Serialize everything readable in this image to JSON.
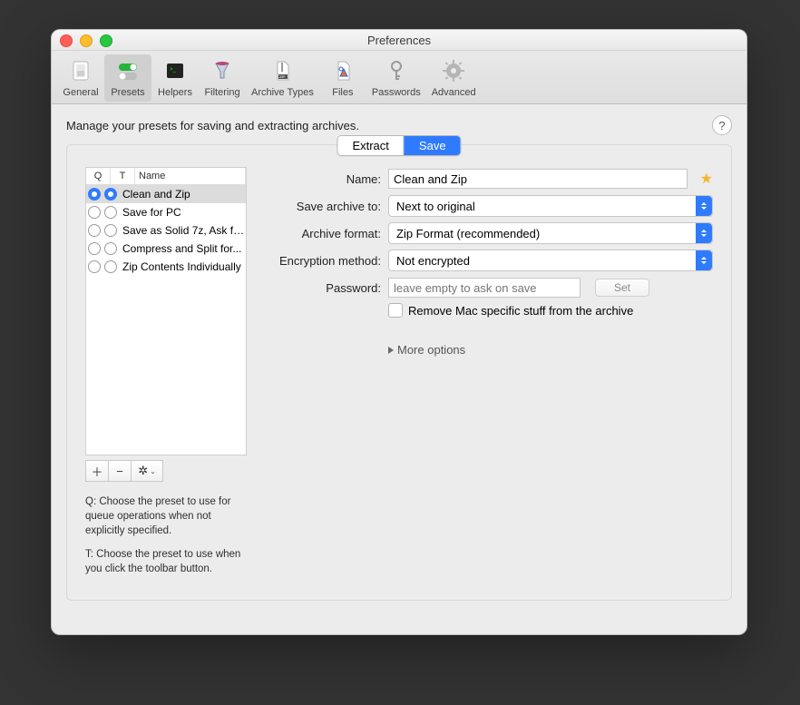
{
  "window": {
    "title": "Preferences"
  },
  "toolbar": {
    "items": [
      {
        "id": "general",
        "label": "General"
      },
      {
        "id": "presets",
        "label": "Presets",
        "selected": true
      },
      {
        "id": "helpers",
        "label": "Helpers"
      },
      {
        "id": "filtering",
        "label": "Filtering"
      },
      {
        "id": "archive-types",
        "label": "Archive Types"
      },
      {
        "id": "files",
        "label": "Files"
      },
      {
        "id": "passwords",
        "label": "Passwords"
      },
      {
        "id": "advanced",
        "label": "Advanced"
      }
    ]
  },
  "intro": "Manage your presets for saving and extracting archives.",
  "help_glyph": "?",
  "segmented": {
    "extract": "Extract",
    "save": "Save",
    "active": "save"
  },
  "list": {
    "headers": {
      "q": "Q",
      "t": "T",
      "name": "Name"
    },
    "rows": [
      {
        "q": true,
        "t": true,
        "name": "Clean and Zip",
        "selected": true
      },
      {
        "q": false,
        "t": false,
        "name": "Save for PC"
      },
      {
        "q": false,
        "t": false,
        "name": "Save as Solid 7z, Ask fo..."
      },
      {
        "q": false,
        "t": false,
        "name": "Compress and Split for..."
      },
      {
        "q": false,
        "t": false,
        "name": "Zip Contents Individually"
      }
    ],
    "buttons": {
      "add": "+",
      "remove": "−",
      "gear": "✱",
      "chev": "﹀"
    }
  },
  "hints": {
    "q": "Q: Choose the preset to use for queue operations when not explicitly specified.",
    "t": "T: Choose the preset to use when you click the toolbar button."
  },
  "form": {
    "name_label": "Name:",
    "name_value": "Clean and Zip",
    "save_to_label": "Save archive to:",
    "save_to_value": "Next to original",
    "format_label": "Archive format:",
    "format_value": "Zip Format (recommended)",
    "encryption_label": "Encryption method:",
    "encryption_value": "Not encrypted",
    "password_label": "Password:",
    "password_placeholder": "leave empty to ask on save",
    "set_button": "Set",
    "remove_mac": "Remove Mac specific stuff from the archive",
    "more_options": "More options"
  }
}
